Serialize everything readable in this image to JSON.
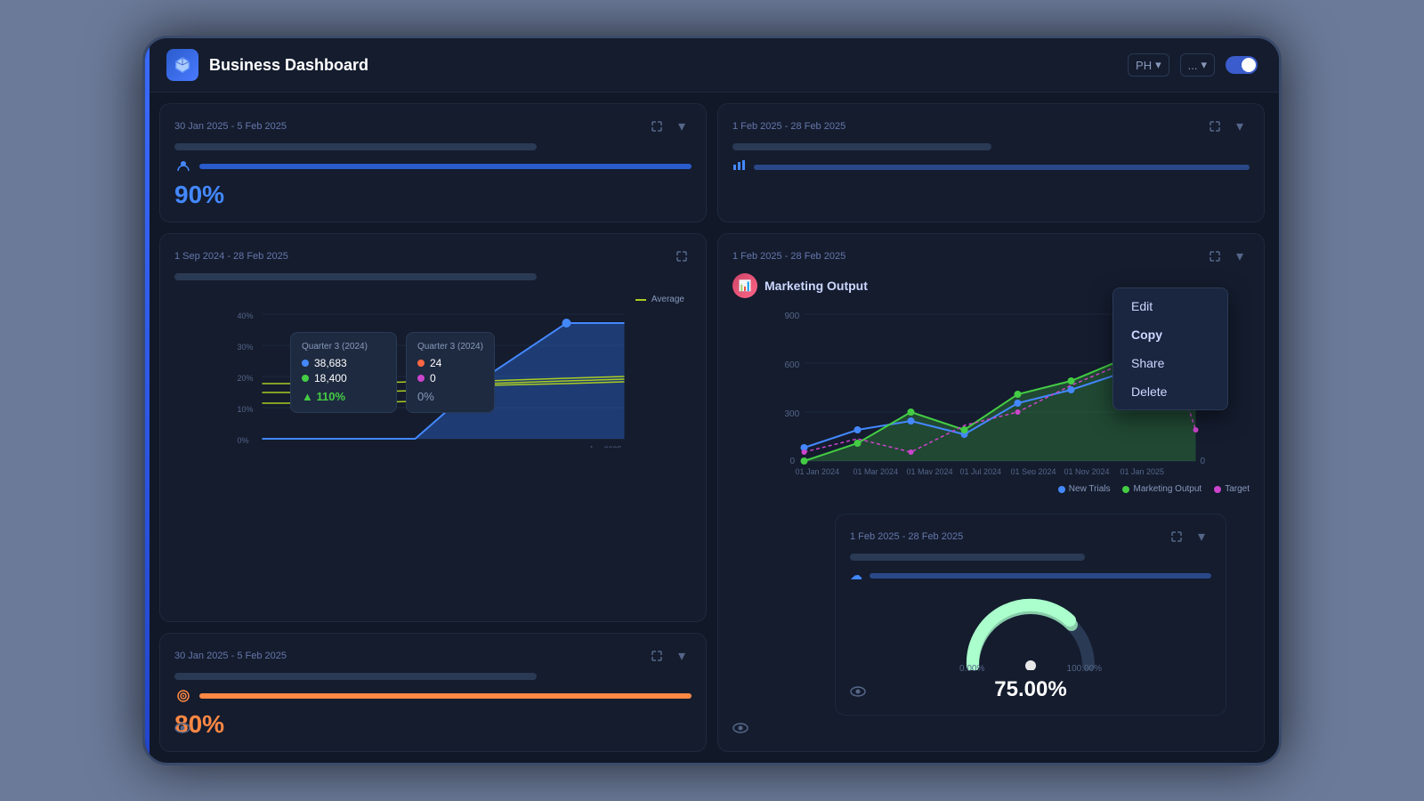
{
  "header": {
    "title": "Business Dashboard",
    "logo_alt": "app-logo",
    "controls": {
      "view_btn": "PH",
      "more_btn": "...",
      "toggle_state": "on"
    }
  },
  "cards": {
    "top_left": {
      "date": "30 Jan 2025 - 5 Feb 2025",
      "metric_value": "90%",
      "metric_color": "#4488ff"
    },
    "top_right_small": {
      "date": "1 Feb 2025 - 28 Feb 2025"
    },
    "marketing_output": {
      "date": "1 Feb 2025 - 28 Feb 2025",
      "title": "Marketing Output",
      "y_labels": [
        "0",
        "300",
        "600",
        "900"
      ],
      "x_labels": [
        "01 Jan 2024",
        "01 Mar 2024",
        "01 May 2024",
        "01 Jul 2024",
        "01 Sep 2024",
        "01 Nov 2024",
        "01 Jan 2025"
      ],
      "right_y_labels": [
        "0"
      ],
      "legend": [
        {
          "label": "New Trials",
          "color": "#4488ff"
        },
        {
          "label": "Marketing Output",
          "color": "#44cc44"
        },
        {
          "label": "Target",
          "color": "#cc44cc"
        }
      ]
    },
    "chart_main": {
      "date": "1 Sep 2024 - 28 Feb 2025",
      "y_labels": [
        "0%",
        "10%",
        "20%",
        "30%",
        "40%"
      ],
      "legend_average": "Average",
      "tooltip1": {
        "title": "Quarter 3 (2024)",
        "val1": "38,683",
        "val1_color": "#4488ff",
        "val2": "18,400",
        "val2_color": "#44cc44",
        "change": "110%",
        "change_direction": "up"
      },
      "tooltip2": {
        "title": "Quarter 3 (2024)",
        "val1": "24",
        "val1_color": "#ff6644",
        "val2": "0",
        "val2_color": "#cc44cc",
        "change": "0%",
        "change_direction": "neutral"
      }
    },
    "bottom_left": {
      "date": "30 Jan 2025 - 5 Feb 2025",
      "metric_value": "80%",
      "metric_color": "#ff8844"
    },
    "gauge": {
      "date": "1 Feb 2025 - 28 Feb 2025",
      "value": "75.00%",
      "min_label": "0.00%",
      "max_label": "100.00%",
      "gauge_percent": 75
    }
  },
  "context_menu": {
    "items": [
      "Edit",
      "Copy",
      "Share",
      "Delete"
    ]
  }
}
